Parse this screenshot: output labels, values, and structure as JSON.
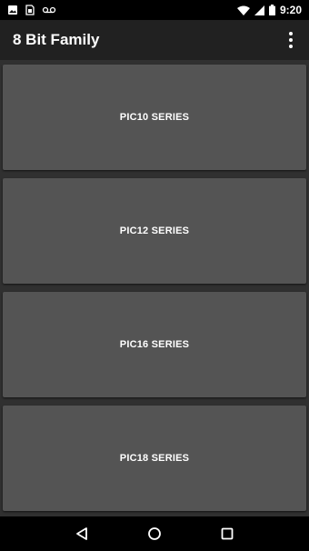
{
  "status_bar": {
    "time": "9:20",
    "left_icons": [
      "image-notification-icon",
      "sim-notification-icon",
      "voicemail-icon"
    ],
    "right_icons": [
      "wifi-icon",
      "cell-signal-icon",
      "battery-icon"
    ]
  },
  "app_bar": {
    "title": "8 Bit Family",
    "menu_icon": "overflow-menu-icon"
  },
  "series": [
    {
      "label": "PIC10 SERIES"
    },
    {
      "label": "PIC12 SERIES"
    },
    {
      "label": "PIC16 SERIES"
    },
    {
      "label": "PIC18 SERIES"
    }
  ],
  "nav_bar": {
    "back_icon": "back-icon",
    "home_icon": "home-icon",
    "recents_icon": "recents-icon"
  },
  "colors": {
    "status_bar": "#000000",
    "app_bar": "#212121",
    "background": "#303030",
    "card": "#545454",
    "text": "#ffffff"
  }
}
